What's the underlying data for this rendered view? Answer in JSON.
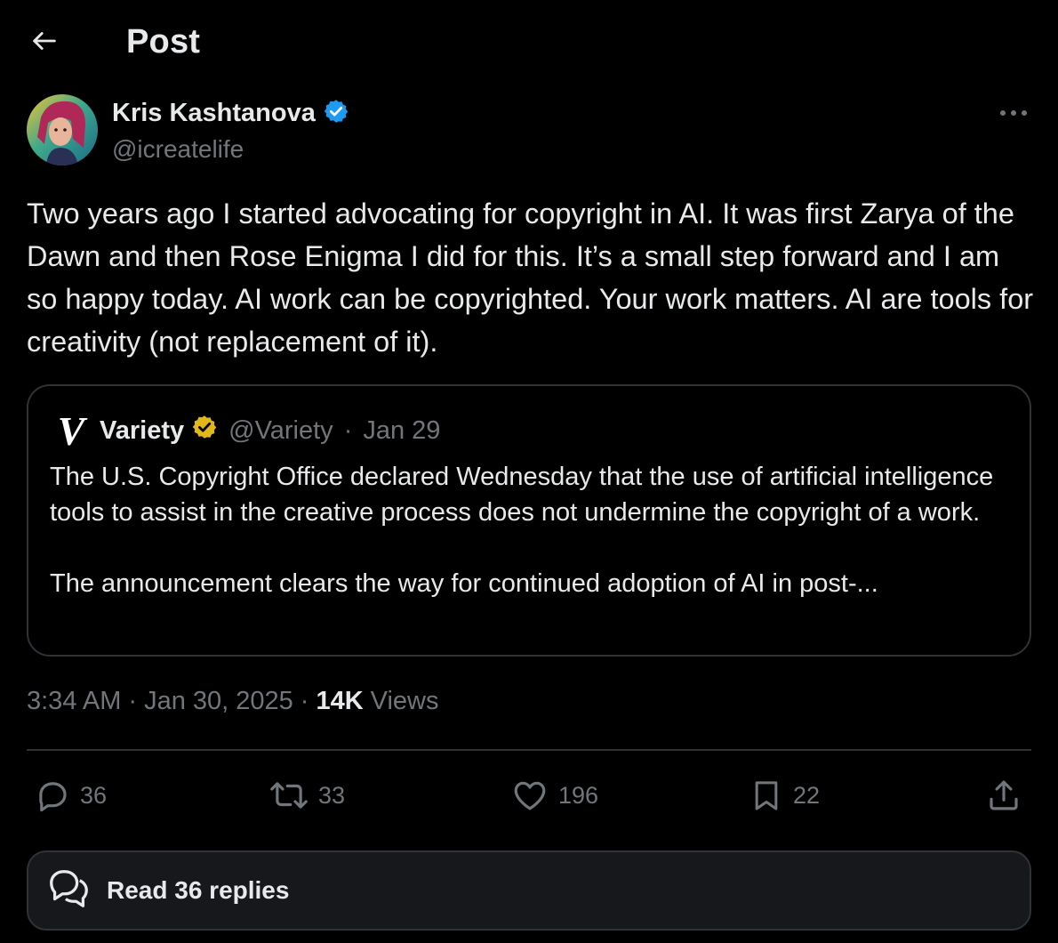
{
  "header": {
    "title": "Post",
    "back_icon": "arrow-left-icon"
  },
  "author": {
    "name": "Kris Kashtanova",
    "handle": "@icreatelife",
    "verified_color": "#1d9bf0",
    "more_icon": "more-horizontal-icon"
  },
  "post": {
    "text": "Two years ago I started advocating for copyright in AI. It was first Zarya of the Dawn and then Rose Enigma I did for this. It’s a small step forward and I am so happy today. AI work can be copyrighted. Your work matters. AI are tools for creativity (not replacement of it)."
  },
  "quote": {
    "name": "Variety",
    "handle": "@Variety",
    "separator": "·",
    "date": "Jan 29",
    "verified_color": "#e2b719",
    "logo_letter": "V",
    "text": "The U.S. Copyright Office declared Wednesday that the use of artificial intelligence tools to assist in the creative process does not undermine the copyright of a work.\n\nThe announcement clears the way for continued adoption of AI in post-..."
  },
  "meta": {
    "time": "3:34 AM",
    "separator": "·",
    "date": "Jan 30, 2025",
    "views_count": "14K",
    "views_label": "Views"
  },
  "actions": {
    "replies": "36",
    "reposts": "33",
    "likes": "196",
    "bookmarks": "22",
    "icons": [
      "reply-icon",
      "repost-icon",
      "like-icon",
      "bookmark-icon",
      "share-icon"
    ]
  },
  "read_replies": {
    "label": "Read 36 replies",
    "icon": "speech-bubbles-icon"
  },
  "colors": {
    "background": "#000000",
    "text": "#e7e9ea",
    "muted": "#71767b",
    "border": "#2f3336"
  }
}
